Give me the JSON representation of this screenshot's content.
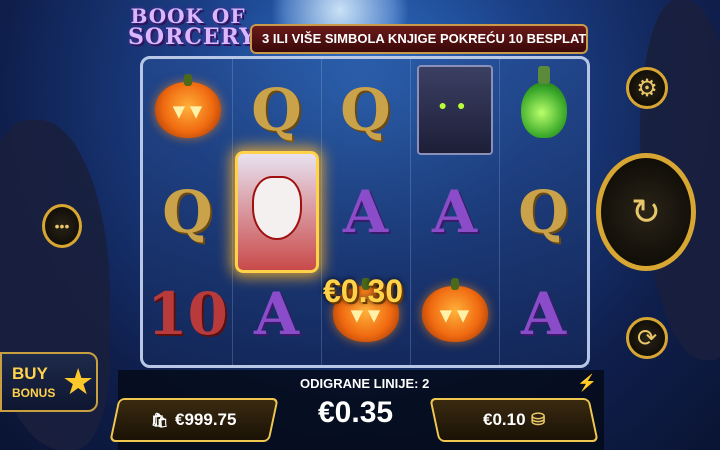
{
  "game": {
    "logo_line1": "BOOK OF",
    "logo_line2": "SORCERY",
    "banner_text": "3 ILI VIŠE SIMBOLA KNJIGE POKREĆU 10 BESPLATN"
  },
  "reels": [
    [
      {
        "symbol": "pumpkin",
        "label": ""
      },
      {
        "symbol": "Q",
        "label": "Q"
      },
      {
        "symbol": "10",
        "label": "10"
      }
    ],
    [
      {
        "symbol": "Q",
        "label": "Q"
      },
      {
        "symbol": "card",
        "label": ""
      },
      {
        "symbol": "A",
        "label": "A"
      }
    ],
    [
      {
        "symbol": "Q",
        "label": "Q"
      },
      {
        "symbol": "A",
        "label": "A"
      },
      {
        "symbol": "pumpkin",
        "label": ""
      }
    ],
    [
      {
        "symbol": "cat",
        "label": ""
      },
      {
        "symbol": "A",
        "label": "A"
      },
      {
        "symbol": "pumpkin",
        "label": ""
      }
    ],
    [
      {
        "symbol": "potion",
        "label": ""
      },
      {
        "symbol": "Q",
        "label": "Q"
      },
      {
        "symbol": "A",
        "label": "A"
      }
    ]
  ],
  "win": {
    "amount": "€0.30"
  },
  "controls": {
    "settings_icon": "⚙",
    "spin_icon": "↻",
    "autoplay_icon": "⟳",
    "menu_icon": "•••"
  },
  "buy_bonus": {
    "line1": "BUY",
    "line2": "BONUS",
    "star": "★"
  },
  "bottom": {
    "lines_label": "ODIGRANE LINIJE: 2",
    "total_bet": "€0.35",
    "balance": "€999.75",
    "balance_icon": "🛍",
    "coin_value": "€0.10",
    "coin_icon": "⛁",
    "turbo_icon": "⚡"
  }
}
